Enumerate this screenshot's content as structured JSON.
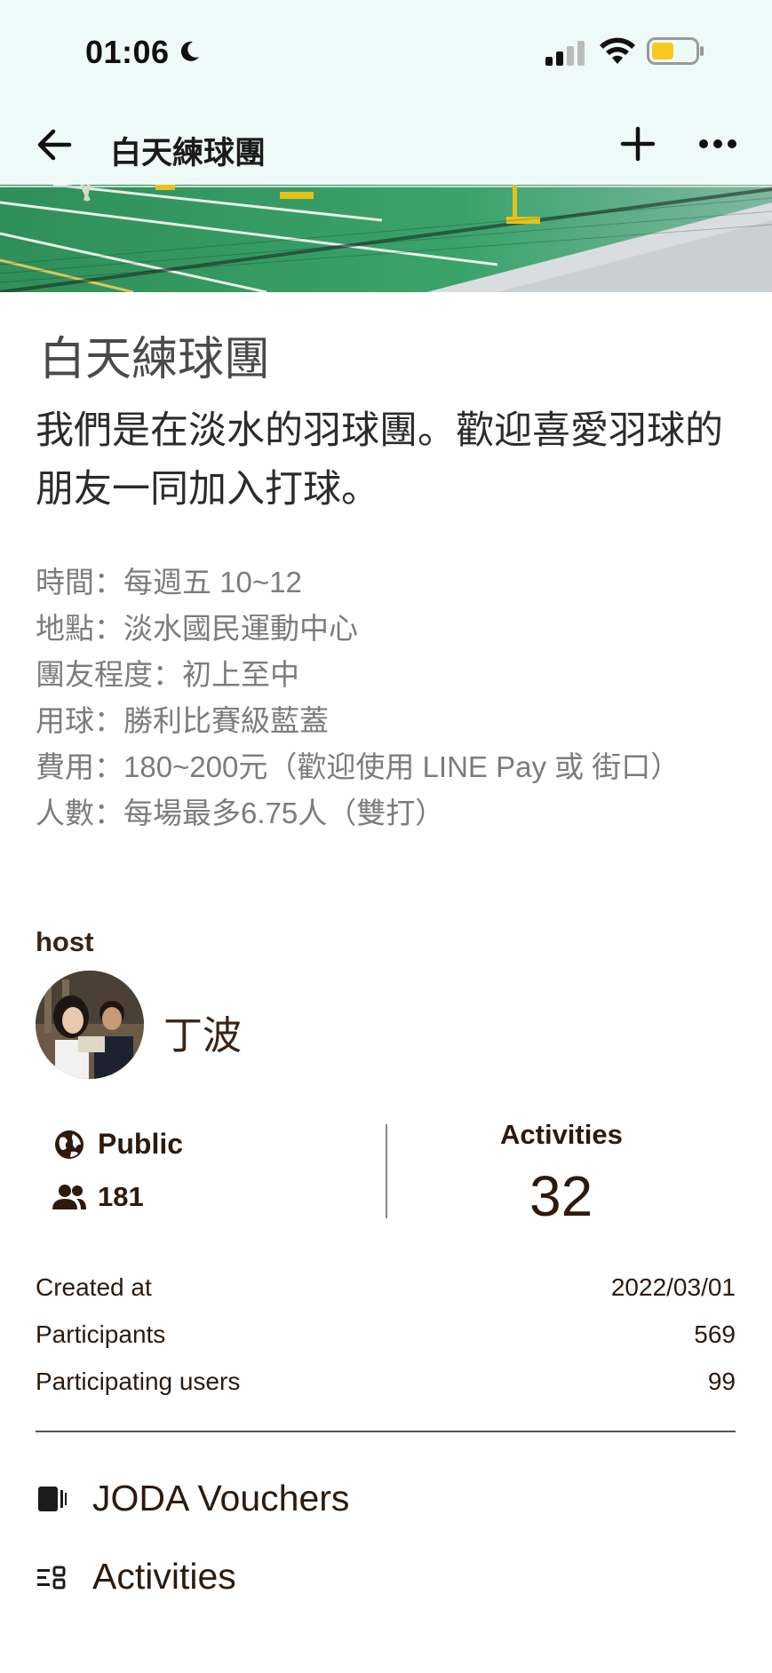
{
  "status_bar": {
    "time": "01:06"
  },
  "nav": {
    "title": "白天練球團"
  },
  "group": {
    "name": "白天練球團",
    "description": "我們是在淡水的羽球團。歡迎喜愛羽球的朋友一同加入打球。",
    "details": [
      "時間：每週五 10~12",
      "地點：淡水國民運動中心",
      "團友程度：初上至中",
      "用球：勝利比賽級藍蓋",
      "費用：180~200元（歡迎使用 LINE Pay 或 街口）",
      "人數：每場最多6.75人（雙打）"
    ]
  },
  "host": {
    "label": "host",
    "name": "丁波"
  },
  "summary": {
    "privacy": "Public",
    "members": "181",
    "activities_label": "Activities",
    "activities_count": "32"
  },
  "stats": [
    {
      "label": "Created at",
      "value": "2022/03/01"
    },
    {
      "label": "Participants",
      "value": "569"
    },
    {
      "label": "Participating users",
      "value": "99"
    }
  ],
  "menu": {
    "vouchers": "JODA Vouchers",
    "activities": "Activities"
  },
  "colors": {
    "header_bg": "#eefaf7",
    "text_brown": "#2d1a0c",
    "battery_yellow": "#f7c81e"
  }
}
